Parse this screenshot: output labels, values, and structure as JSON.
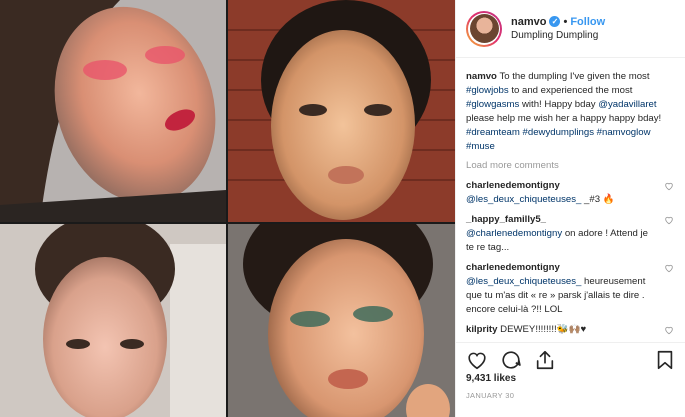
{
  "header": {
    "username": "namvo",
    "follow_label": "Follow",
    "location": "Dumpling Dumpling"
  },
  "caption": {
    "username": "namvo",
    "text_1": "To the dumpling I've given the most",
    "tag_glowjobs": "#glowjobs",
    "text_2": "to and experienced the most",
    "tag_glowgasms": "#glowgasms",
    "text_3": "with! Happy bday",
    "mention_yadavillaret": "@yadavillaret",
    "text_4": "please help me wish her a happy happy bday!",
    "tag_dreamteam": "#dreamteam",
    "tag_dewydumplings": "#dewydumplings",
    "tag_namvoglow": "#namvoglow",
    "tag_muse": "#muse"
  },
  "load_more_label": "Load more comments",
  "comments": [
    {
      "username": "charlenedemontigny",
      "mention": "@les_deux_chiqueteuses_",
      "text": "_#3 🔥"
    },
    {
      "username": "_happy_familly5_",
      "mention": "@charlenedemontigny",
      "text": "on adore ! Attend je te re tag..."
    },
    {
      "username": "charlenedemontigny",
      "mention": "@les_deux_chiqueteuses_",
      "text": "heureusement que tu m'as dit « re » parsk j'allais te dire . encore celui-là ?!! LOL"
    },
    {
      "username": "kilprity",
      "mention": "",
      "text": "DEWEY!!!!!!!!🐝🙌🏽♥"
    }
  ],
  "likes": "9,431 likes",
  "date": "JANUARY 30",
  "icons": {
    "verified": "verified-badge-icon",
    "heart": "heart-icon",
    "comment": "comment-icon",
    "share": "share-icon",
    "bookmark": "bookmark-icon"
  },
  "colors": {
    "link": "#003569",
    "follow": "#3897f0",
    "muted": "#999999"
  }
}
